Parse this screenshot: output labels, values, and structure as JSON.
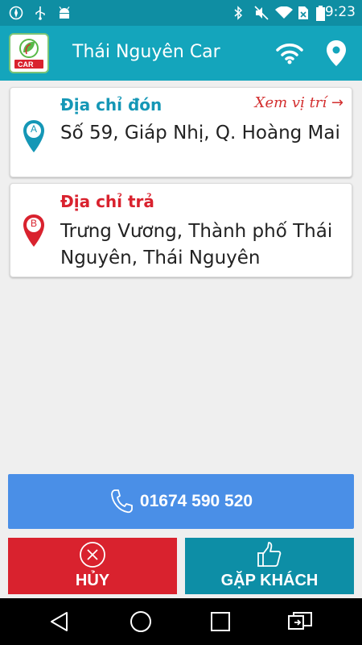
{
  "status_bar": {
    "time": "9:23",
    "icons": [
      "compass-icon",
      "usb-icon",
      "android-icon",
      "bluetooth-icon",
      "mute-icon",
      "wifi-icon",
      "no-sim-icon",
      "battery-icon"
    ]
  },
  "app_bar": {
    "title": "Thái Nguyên Car",
    "logo_text": "CAR",
    "actions": [
      "wifi-icon",
      "location-pin-icon"
    ]
  },
  "pickup": {
    "label": "Địa chỉ đón",
    "marker_letter": "A",
    "address": "Số 59, Giáp Nhị, Q. Hoàng Mai",
    "view_location": "Xem vị trí",
    "label_color": "#1597b6"
  },
  "dropoff": {
    "label": "Địa chỉ trả",
    "marker_letter": "B",
    "address": "Trưng Vương, Thành phố Thái Nguyên, Thái Nguyên",
    "label_color": "#d9222e"
  },
  "call": {
    "phone": "01674 590 520"
  },
  "actions": {
    "cancel_label": "HỦY",
    "meet_label": "GẶP KHÁCH"
  },
  "colors": {
    "primary": "#14a5bc",
    "status_bar": "#0f8ea3",
    "call_button": "#4a8fe7",
    "cancel_button": "#d9222e",
    "meet_button": "#0d8ea6"
  }
}
